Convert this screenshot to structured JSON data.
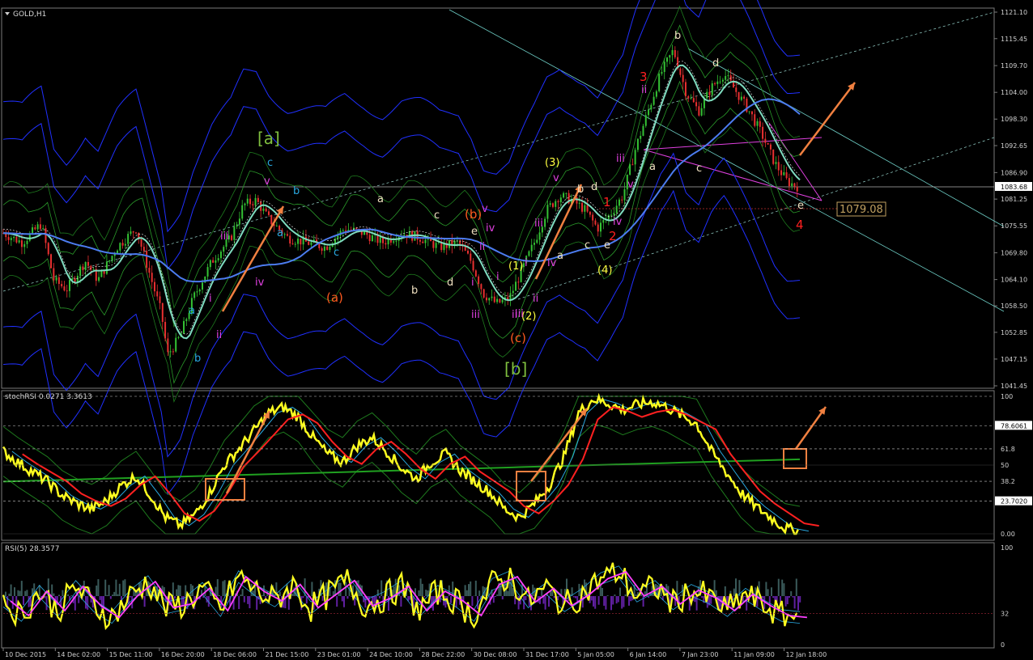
{
  "window": {
    "symbol_title": "GOLD,H1"
  },
  "chart_data": [
    {
      "type": "line",
      "pane": "price",
      "title": "GOLD,H1",
      "ylim": [
        1041.45,
        1121.1
      ],
      "y_ticks": [
        "1121.10",
        "1115.45",
        "1109.70",
        "1104.00",
        "1098.30",
        "1092.65",
        "1086.90",
        "1081.25",
        "1075.55",
        "1069.80",
        "1064.10",
        "1058.50",
        "1052.85",
        "1047.15",
        "1041.45"
      ],
      "x_ticks": [
        "10 Dec 2015",
        "14 Dec 02:00",
        "15 Dec 11:00",
        "16 Dec 20:00",
        "18 Dec 06:00",
        "21 Dec 15:00",
        "23 Dec 01:00",
        "24 Dec 10:00",
        "28 Dec 22:00",
        "30 Dec 08:00",
        "31 Dec 17:00",
        "5 Jan 05:00",
        "6 Jan 14:00",
        "7 Jan 23:00",
        "11 Jan 09:00",
        "12 Jan 18:00"
      ],
      "current_price_label": "1083.68",
      "target_price_label": "1079.08",
      "price_path": [
        [
          0,
          1074
        ],
        [
          3,
          1072
        ],
        [
          6,
          1076
        ],
        [
          8,
          1064
        ],
        [
          10,
          1062
        ],
        [
          13,
          1068
        ],
        [
          15,
          1064
        ],
        [
          18,
          1071
        ],
        [
          21,
          1075
        ],
        [
          23,
          1066
        ],
        [
          25,
          1057
        ],
        [
          26,
          1048
        ],
        [
          28,
          1052
        ],
        [
          30,
          1060
        ],
        [
          33,
          1068
        ],
        [
          36,
          1073
        ],
        [
          38,
          1080
        ],
        [
          40,
          1081
        ],
        [
          42,
          1077
        ],
        [
          45,
          1073
        ],
        [
          48,
          1072
        ],
        [
          51,
          1071
        ],
        [
          54,
          1075
        ],
        [
          57,
          1074
        ],
        [
          60,
          1072
        ],
        [
          63,
          1074
        ],
        [
          66,
          1073
        ],
        [
          69,
          1071
        ],
        [
          72,
          1072
        ],
        [
          74,
          1068
        ],
        [
          76,
          1061
        ],
        [
          78,
          1059
        ],
        [
          80,
          1060
        ],
        [
          82,
          1066
        ],
        [
          84,
          1072
        ],
        [
          86,
          1079
        ],
        [
          88,
          1082
        ],
        [
          90,
          1081
        ],
        [
          92,
          1079
        ],
        [
          94,
          1075
        ],
        [
          96,
          1078
        ],
        [
          98,
          1082
        ],
        [
          100,
          1092
        ],
        [
          102,
          1100
        ],
        [
          104,
          1108
        ],
        [
          106,
          1113
        ],
        [
          108,
          1104
        ],
        [
          110,
          1100
        ],
        [
          112,
          1105
        ],
        [
          114,
          1108
        ],
        [
          116,
          1104
        ],
        [
          118,
          1100
        ],
        [
          120,
          1095
        ],
        [
          122,
          1089
        ],
        [
          124,
          1085
        ],
        [
          126,
          1083.68
        ]
      ]
    },
    {
      "type": "line",
      "pane": "stochRSI",
      "title": "stochRSI 0.0271 3.3613",
      "ylim": [
        0,
        100
      ],
      "y_ticks": [
        "100",
        "78.6061",
        "61.8",
        "50",
        "38.2",
        "23.7020",
        "0.00"
      ],
      "series": [
        {
          "values": [
            60,
            52,
            45,
            38,
            28,
            22,
            18,
            24,
            35,
            42,
            28,
            12,
            6,
            14,
            30,
            50,
            62,
            75,
            88,
            92,
            85,
            70,
            58,
            52,
            64,
            70,
            60,
            48,
            40,
            52,
            58,
            46,
            38,
            30,
            18,
            12,
            22,
            35,
            56,
            88,
            98,
            95,
            90,
            94,
            96,
            92,
            86,
            80,
            60,
            45,
            30,
            20,
            12,
            4,
            2
          ]
        }
      ]
    },
    {
      "type": "line",
      "pane": "RSI",
      "title": "RSI(5) 28.3577",
      "ylim": [
        0,
        100
      ],
      "y_ticks": [
        "100",
        "32",
        "0"
      ],
      "series": [
        {
          "values": [
            45,
            30,
            55,
            35,
            60,
            40,
            28,
            50,
            65,
            38,
            42,
            58,
            35,
            70,
            55,
            45,
            62,
            38,
            52,
            66,
            40,
            48,
            60,
            35,
            55,
            45,
            30,
            62,
            70,
            44,
            58,
            40,
            52,
            68,
            75,
            50,
            60,
            42,
            56,
            48,
            35,
            52,
            40,
            30,
            28
          ]
        }
      ]
    }
  ],
  "wave_labels": [
    {
      "text": "[a]",
      "color": "#7fbf3f",
      "size": "big"
    },
    {
      "text": "[b]",
      "color": "#7fbf3f",
      "size": "big"
    },
    {
      "text": "(a)",
      "color": "#ff5a1f",
      "size": "mid"
    },
    {
      "text": "(b)",
      "color": "#ff5a1f",
      "size": "mid"
    },
    {
      "text": "(c)",
      "color": "#ff5a1f",
      "size": "mid"
    },
    {
      "text": "(1)",
      "color": "#ffff40",
      "size": "small"
    },
    {
      "text": "(2)",
      "color": "#ffff40",
      "size": "small"
    },
    {
      "text": "(3)",
      "color": "#ffff40",
      "size": "small"
    },
    {
      "text": "(4)",
      "color": "#ffff40",
      "size": "small"
    },
    {
      "text": "1",
      "color": "#ff2020",
      "size": "mid"
    },
    {
      "text": "2",
      "color": "#ff2020",
      "size": "mid"
    },
    {
      "text": "3",
      "color": "#ff2020",
      "size": "mid"
    },
    {
      "text": "4",
      "color": "#ff2020",
      "size": "mid"
    },
    {
      "text": "a",
      "color": "#29a8e0",
      "size": "small"
    },
    {
      "text": "b",
      "color": "#29a8e0",
      "size": "small"
    },
    {
      "text": "c",
      "color": "#29a8e0",
      "size": "small"
    },
    {
      "text": "a",
      "color": "#29a8e0",
      "size": "small"
    },
    {
      "text": "b",
      "color": "#29a8e0",
      "size": "small"
    },
    {
      "text": "c",
      "color": "#29a8e0",
      "size": "small"
    },
    {
      "text": "i",
      "color": "#e040e0",
      "size": "small"
    },
    {
      "text": "ii",
      "color": "#e040e0",
      "size": "small"
    },
    {
      "text": "iii",
      "color": "#e040e0",
      "size": "small"
    },
    {
      "text": "iv",
      "color": "#e040e0",
      "size": "small"
    },
    {
      "text": "v",
      "color": "#e040e0",
      "size": "small"
    },
    {
      "text": "iii",
      "color": "#e040e0",
      "size": "small"
    },
    {
      "text": "i",
      "color": "#e040e0",
      "size": "small"
    },
    {
      "text": "ii",
      "color": "#e040e0",
      "size": "small"
    },
    {
      "text": "i",
      "color": "#e040e0",
      "size": "small"
    },
    {
      "text": "ii",
      "color": "#e040e0",
      "size": "small"
    },
    {
      "text": "iii",
      "color": "#e040e0",
      "size": "small"
    },
    {
      "text": "iv",
      "color": "#e040e0",
      "size": "small"
    },
    {
      "text": "v",
      "color": "#e040e0",
      "size": "small"
    },
    {
      "text": "i",
      "color": "#e040e0",
      "size": "small"
    },
    {
      "text": "ii",
      "color": "#e040e0",
      "size": "small"
    },
    {
      "text": "iii",
      "color": "#e040e0",
      "size": "small"
    },
    {
      "text": "iv",
      "color": "#e040e0",
      "size": "small"
    },
    {
      "text": "v",
      "color": "#e040e0",
      "size": "small"
    },
    {
      "text": "ii",
      "color": "#e040e0",
      "size": "small"
    },
    {
      "text": "iii",
      "color": "#e040e0",
      "size": "small"
    },
    {
      "text": "iv",
      "color": "#e040e0",
      "size": "small"
    },
    {
      "text": "v",
      "color": "#e040e0",
      "size": "small"
    },
    {
      "text": "a",
      "color": "#f0e0c0",
      "size": "small"
    },
    {
      "text": "b",
      "color": "#f0e0c0",
      "size": "small"
    },
    {
      "text": "c",
      "color": "#f0e0c0",
      "size": "small"
    },
    {
      "text": "d",
      "color": "#f0e0c0",
      "size": "small"
    },
    {
      "text": "e",
      "color": "#f0e0c0",
      "size": "small"
    },
    {
      "text": "a",
      "color": "#f0e0c0",
      "size": "small"
    },
    {
      "text": "b",
      "color": "#f0e0c0",
      "size": "small"
    },
    {
      "text": "c",
      "color": "#f0e0c0",
      "size": "small"
    },
    {
      "text": "d",
      "color": "#f0e0c0",
      "size": "small"
    },
    {
      "text": "e",
      "color": "#f0e0c0",
      "size": "small"
    },
    {
      "text": "a",
      "color": "#f0e0c0",
      "size": "small"
    },
    {
      "text": "b",
      "color": "#f0e0c0",
      "size": "small"
    },
    {
      "text": "c",
      "color": "#f0e0c0",
      "size": "small"
    },
    {
      "text": "d",
      "color": "#f0e0c0",
      "size": "small"
    },
    {
      "text": "e",
      "color": "#f0e0c0",
      "size": "small"
    }
  ],
  "colors": {
    "background": "#000000",
    "grid": "#404040",
    "axis_text": "#d0d0d0",
    "bollinger_blue": "#2030ff",
    "envelope_green": "#1e7a1e",
    "ma_teal": "#7fdcc0",
    "ma_blue": "#4c7cf0",
    "channel_cyan": "#6fd0c8",
    "arrow": "#f08040",
    "stoch_yellow": "#ffff20",
    "signal_red": "#ff2020",
    "rsi_magenta": "#ff40ff",
    "hist_teal": "#3a5a5a",
    "hist_purple": "#6020a0",
    "price_box": "#c0a060"
  }
}
